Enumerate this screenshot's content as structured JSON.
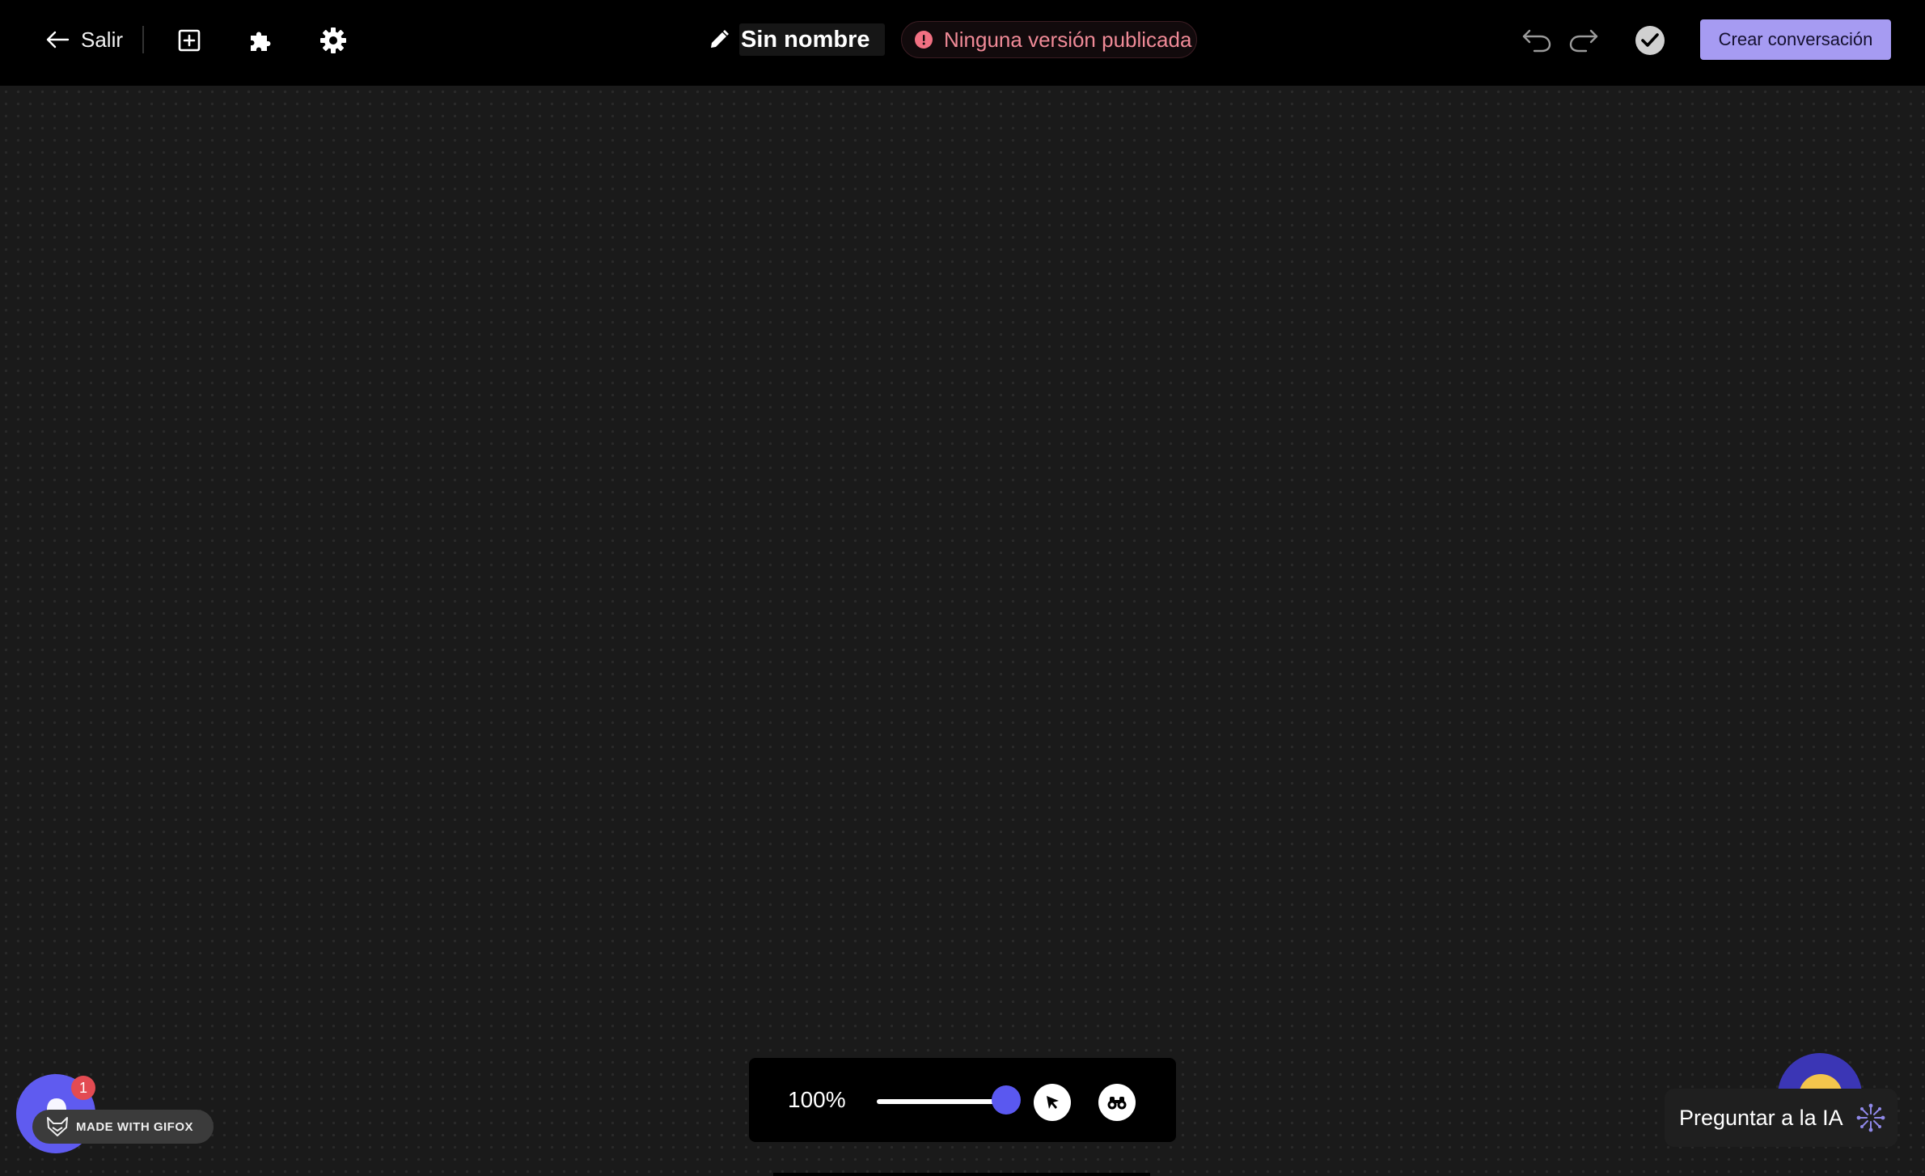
{
  "topbar": {
    "exit_label": "Salir",
    "icons": {
      "back": "arrow-left-icon",
      "add": "add-square-icon",
      "plugins": "puzzle-icon",
      "settings": "gear-icon",
      "edit": "pencil-icon",
      "undo": "undo-icon",
      "redo": "redo-icon",
      "check": "check-circle-icon"
    },
    "title_value": "Sin nombre",
    "status_text": "Ninguna versión publicada",
    "primary_button": "Crear conversación"
  },
  "zoom_controls": {
    "zoom_label": "100%",
    "zoom_slider_fraction": 1.0,
    "tools": [
      "pointer-icon",
      "binoculars-icon"
    ]
  },
  "help_widget": {
    "badge_count": "1",
    "gifox_label": "MADE WITH GIFOX"
  },
  "ai_widget": {
    "label": "Preguntar a la IA",
    "icon": "sparkle-icon"
  },
  "colors": {
    "background": "#1a1a1a",
    "topbar": "#000000",
    "accent": "#a69bf2",
    "slider_thumb": "#5a58f0",
    "status_text": "#f08a97",
    "badge": "#e34b52"
  }
}
